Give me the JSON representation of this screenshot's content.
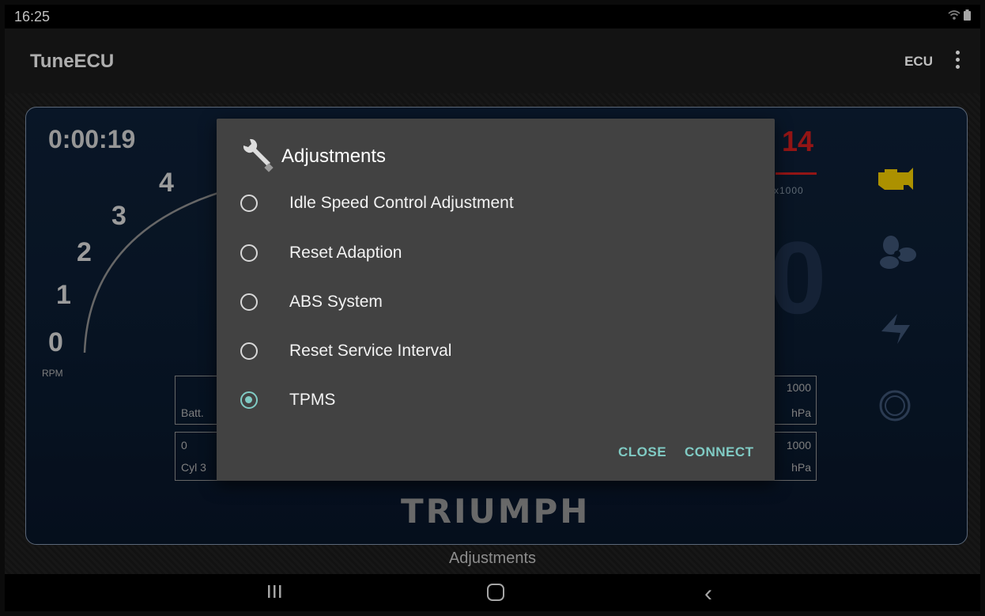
{
  "status": {
    "time": "16:25",
    "wifi_icon": "wifi-icon",
    "battery_icon": "battery-icon"
  },
  "app": {
    "title": "TuneECU",
    "ecu_label": "ECU",
    "overflow_icon": "more-vert-icon"
  },
  "dash": {
    "timer": "0:00:19",
    "rpm_scale": [
      "0",
      "1",
      "2",
      "3",
      "4"
    ],
    "rpm_label": "RPM",
    "gear_or_temp": "14",
    "multiplier": "x1000",
    "big_value": "0",
    "left_box_top": "Batt.",
    "left_box_bottom_value": "0",
    "left_box_bottom_label": "Cyl 3",
    "right_box_top_value": "1000",
    "right_box_top_unit": "hPa",
    "right_box_bottom_value": "1000",
    "right_box_bottom_unit": "hPa",
    "brand": "TRIUMPH",
    "status_icons": [
      "engine-icon",
      "fan-icon",
      "refresh-icon",
      "circle-icon"
    ]
  },
  "bottom_label": "Adjustments",
  "dialog": {
    "icon": "wrench-icon",
    "title": "Adjustments",
    "options": [
      {
        "label": "Idle Speed Control Adjustment",
        "selected": false
      },
      {
        "label": "Reset Adaption",
        "selected": false
      },
      {
        "label": "ABS System",
        "selected": false
      },
      {
        "label": "Reset Service Interval",
        "selected": false
      },
      {
        "label": "TPMS",
        "selected": true
      }
    ],
    "close_label": "CLOSE",
    "connect_label": "CONNECT"
  },
  "colors": {
    "accent": "#80cbc4",
    "dialog_bg": "#424242",
    "warn_red": "#c41d1d",
    "engine_yellow": "#e6c200"
  }
}
